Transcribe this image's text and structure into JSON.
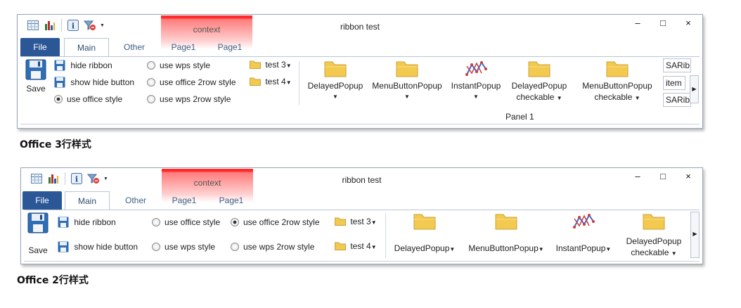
{
  "window1": {
    "title": "ribbon test",
    "context_label": "context",
    "win_buttons": [
      "–",
      "□",
      "×"
    ],
    "tabs": [
      "File",
      "Main",
      "Other",
      "Page1",
      "Page1"
    ],
    "save_label": "Save",
    "hide_ribbon": "hide ribbon",
    "show_hide_button": "show hide button",
    "use_office_style": "use office style",
    "use_wps_style": "use wps style",
    "use_office_2row_style": "use office 2row style",
    "use_wps_2row_style": "use wps 2row style",
    "test3": "test 3",
    "test4": "test 4",
    "delayed_popup": "DelayedPopup",
    "menu_button_popup": "MenuButtonPopup",
    "instant_popup": "InstantPopup",
    "delayed_popup_checkable_1": "DelayedPopup",
    "delayed_popup_checkable_2": "checkable",
    "menu_button_popup_checkable_1": "MenuButtonPopup",
    "menu_button_popup_checkable_2": "checkable",
    "panel_label": "Panel 1",
    "textbox1": "SARib",
    "textbox2": "item",
    "textbox3": "SARib",
    "caption": "Office 3行样式"
  },
  "window2": {
    "title": "ribbon test",
    "context_label": "context",
    "win_buttons": [
      "–",
      "□",
      "×"
    ],
    "tabs": [
      "File",
      "Main",
      "Other",
      "Page1",
      "Page1"
    ],
    "save_label": "Save",
    "hide_ribbon": "hide ribbon",
    "show_hide_button": "show hide button",
    "use_office_style": "use office style",
    "use_office_2row_style": "use office 2row style",
    "use_wps_style": "use wps style",
    "use_wps_2row_style": "use wps 2row style",
    "test3": "test 3",
    "test4": "test 4",
    "delayed_popup": "DelayedPopup",
    "menu_button_popup": "MenuButtonPopup",
    "instant_popup": "InstantPopup",
    "delayed_popup_checkable_1": "DelayedPopup",
    "delayed_popup_checkable_2": "checkable",
    "caption": "Office 2行样式"
  },
  "colors": {
    "file_tab": "#2b5797",
    "context_red": "#ff2b2b",
    "tab_text": "#3d5f87",
    "folder": "#f3c94f"
  },
  "icons": [
    "table-icon",
    "bar-chart-icon",
    "info-icon",
    "filter-icon",
    "floppy-icon",
    "folder-icon",
    "line-chart-icon"
  ]
}
